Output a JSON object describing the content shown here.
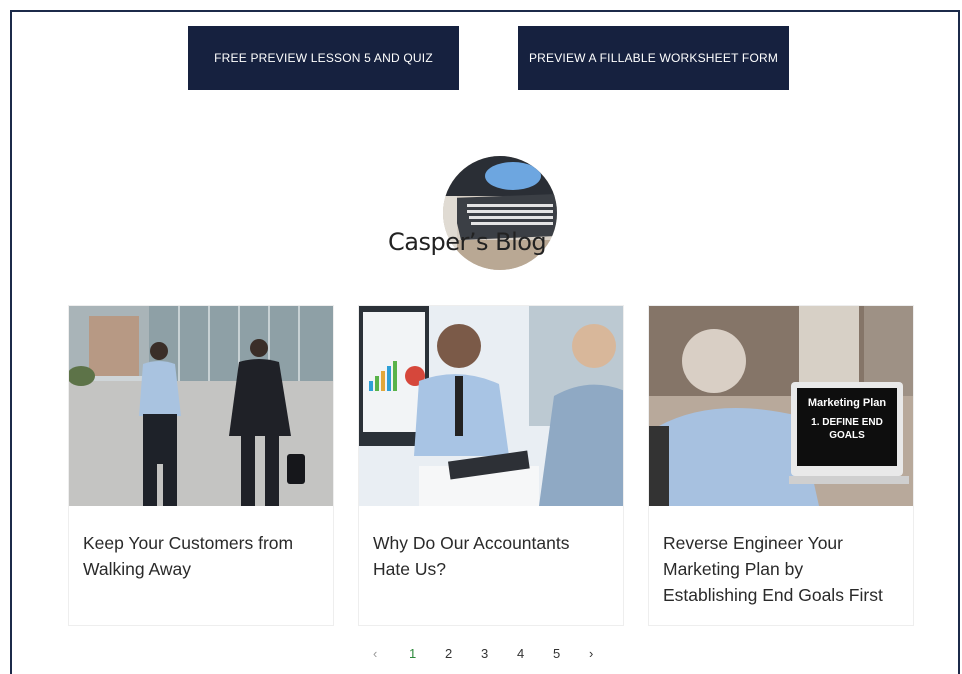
{
  "buttons": {
    "lesson_preview": "FREE PREVIEW LESSON 5 AND QUIZ",
    "worksheet_preview": "PREVIEW A FILLABLE WORKSHEET FORM"
  },
  "blog": {
    "title": "Casper’s Blog"
  },
  "posts": [
    {
      "title": "Keep Your Customers from Walking Away"
    },
    {
      "title": "Why Do Our Accountants Hate Us?"
    },
    {
      "title": "Reverse Engineer Your Marketing Plan by Establishing End Goals First",
      "image_text": [
        "Marketing Plan",
        "1. DEFINE END",
        "GOALS"
      ]
    }
  ],
  "pagination": {
    "prev": "‹",
    "pages": [
      "1",
      "2",
      "3",
      "4",
      "5"
    ],
    "current": "1",
    "next": "›"
  },
  "colors": {
    "button_bg": "#16213f",
    "active_page": "#2e8a3c",
    "frame": "#1c2a4a"
  }
}
